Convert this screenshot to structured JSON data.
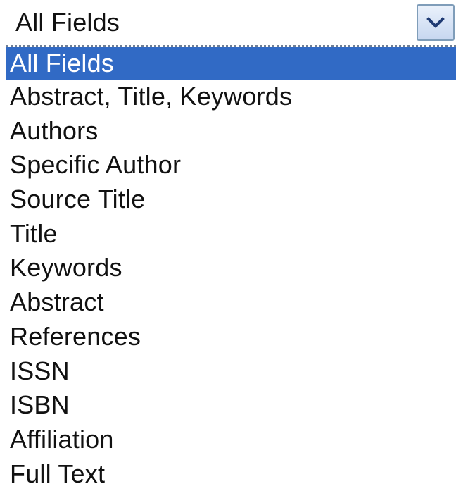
{
  "select": {
    "value": "All Fields",
    "toggle_icon": "chevron-down-icon"
  },
  "colors": {
    "selected_bg": "#316ac5",
    "selected_text": "#ffffff",
    "button_border": "#7f9db9"
  },
  "options": [
    {
      "label": "All Fields",
      "selected": true
    },
    {
      "label": "Abstract, Title, Keywords",
      "selected": false
    },
    {
      "label": "Authors",
      "selected": false
    },
    {
      "label": "Specific Author",
      "selected": false
    },
    {
      "label": "Source Title",
      "selected": false
    },
    {
      "label": "Title",
      "selected": false
    },
    {
      "label": "Keywords",
      "selected": false
    },
    {
      "label": "Abstract",
      "selected": false
    },
    {
      "label": "References",
      "selected": false
    },
    {
      "label": "ISSN",
      "selected": false
    },
    {
      "label": "ISBN",
      "selected": false
    },
    {
      "label": "Affiliation",
      "selected": false
    },
    {
      "label": "Full Text",
      "selected": false
    }
  ]
}
